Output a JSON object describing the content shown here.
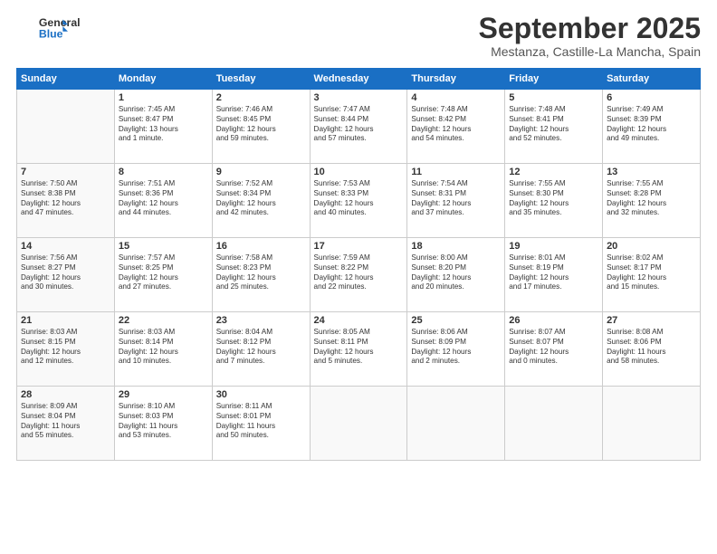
{
  "header": {
    "logo_line1": "General",
    "logo_line2": "Blue",
    "month_title": "September 2025",
    "location": "Mestanza, Castille-La Mancha, Spain"
  },
  "weekdays": [
    "Sunday",
    "Monday",
    "Tuesday",
    "Wednesday",
    "Thursday",
    "Friday",
    "Saturday"
  ],
  "weeks": [
    [
      {
        "day": "",
        "text": ""
      },
      {
        "day": "1",
        "text": "Sunrise: 7:45 AM\nSunset: 8:47 PM\nDaylight: 13 hours\nand 1 minute."
      },
      {
        "day": "2",
        "text": "Sunrise: 7:46 AM\nSunset: 8:45 PM\nDaylight: 12 hours\nand 59 minutes."
      },
      {
        "day": "3",
        "text": "Sunrise: 7:47 AM\nSunset: 8:44 PM\nDaylight: 12 hours\nand 57 minutes."
      },
      {
        "day": "4",
        "text": "Sunrise: 7:48 AM\nSunset: 8:42 PM\nDaylight: 12 hours\nand 54 minutes."
      },
      {
        "day": "5",
        "text": "Sunrise: 7:48 AM\nSunset: 8:41 PM\nDaylight: 12 hours\nand 52 minutes."
      },
      {
        "day": "6",
        "text": "Sunrise: 7:49 AM\nSunset: 8:39 PM\nDaylight: 12 hours\nand 49 minutes."
      }
    ],
    [
      {
        "day": "7",
        "text": "Sunrise: 7:50 AM\nSunset: 8:38 PM\nDaylight: 12 hours\nand 47 minutes."
      },
      {
        "day": "8",
        "text": "Sunrise: 7:51 AM\nSunset: 8:36 PM\nDaylight: 12 hours\nand 44 minutes."
      },
      {
        "day": "9",
        "text": "Sunrise: 7:52 AM\nSunset: 8:34 PM\nDaylight: 12 hours\nand 42 minutes."
      },
      {
        "day": "10",
        "text": "Sunrise: 7:53 AM\nSunset: 8:33 PM\nDaylight: 12 hours\nand 40 minutes."
      },
      {
        "day": "11",
        "text": "Sunrise: 7:54 AM\nSunset: 8:31 PM\nDaylight: 12 hours\nand 37 minutes."
      },
      {
        "day": "12",
        "text": "Sunrise: 7:55 AM\nSunset: 8:30 PM\nDaylight: 12 hours\nand 35 minutes."
      },
      {
        "day": "13",
        "text": "Sunrise: 7:55 AM\nSunset: 8:28 PM\nDaylight: 12 hours\nand 32 minutes."
      }
    ],
    [
      {
        "day": "14",
        "text": "Sunrise: 7:56 AM\nSunset: 8:27 PM\nDaylight: 12 hours\nand 30 minutes."
      },
      {
        "day": "15",
        "text": "Sunrise: 7:57 AM\nSunset: 8:25 PM\nDaylight: 12 hours\nand 27 minutes."
      },
      {
        "day": "16",
        "text": "Sunrise: 7:58 AM\nSunset: 8:23 PM\nDaylight: 12 hours\nand 25 minutes."
      },
      {
        "day": "17",
        "text": "Sunrise: 7:59 AM\nSunset: 8:22 PM\nDaylight: 12 hours\nand 22 minutes."
      },
      {
        "day": "18",
        "text": "Sunrise: 8:00 AM\nSunset: 8:20 PM\nDaylight: 12 hours\nand 20 minutes."
      },
      {
        "day": "19",
        "text": "Sunrise: 8:01 AM\nSunset: 8:19 PM\nDaylight: 12 hours\nand 17 minutes."
      },
      {
        "day": "20",
        "text": "Sunrise: 8:02 AM\nSunset: 8:17 PM\nDaylight: 12 hours\nand 15 minutes."
      }
    ],
    [
      {
        "day": "21",
        "text": "Sunrise: 8:03 AM\nSunset: 8:15 PM\nDaylight: 12 hours\nand 12 minutes."
      },
      {
        "day": "22",
        "text": "Sunrise: 8:03 AM\nSunset: 8:14 PM\nDaylight: 12 hours\nand 10 minutes."
      },
      {
        "day": "23",
        "text": "Sunrise: 8:04 AM\nSunset: 8:12 PM\nDaylight: 12 hours\nand 7 minutes."
      },
      {
        "day": "24",
        "text": "Sunrise: 8:05 AM\nSunset: 8:11 PM\nDaylight: 12 hours\nand 5 minutes."
      },
      {
        "day": "25",
        "text": "Sunrise: 8:06 AM\nSunset: 8:09 PM\nDaylight: 12 hours\nand 2 minutes."
      },
      {
        "day": "26",
        "text": "Sunrise: 8:07 AM\nSunset: 8:07 PM\nDaylight: 12 hours\nand 0 minutes."
      },
      {
        "day": "27",
        "text": "Sunrise: 8:08 AM\nSunset: 8:06 PM\nDaylight: 11 hours\nand 58 minutes."
      }
    ],
    [
      {
        "day": "28",
        "text": "Sunrise: 8:09 AM\nSunset: 8:04 PM\nDaylight: 11 hours\nand 55 minutes."
      },
      {
        "day": "29",
        "text": "Sunrise: 8:10 AM\nSunset: 8:03 PM\nDaylight: 11 hours\nand 53 minutes."
      },
      {
        "day": "30",
        "text": "Sunrise: 8:11 AM\nSunset: 8:01 PM\nDaylight: 11 hours\nand 50 minutes."
      },
      {
        "day": "",
        "text": ""
      },
      {
        "day": "",
        "text": ""
      },
      {
        "day": "",
        "text": ""
      },
      {
        "day": "",
        "text": ""
      }
    ]
  ]
}
